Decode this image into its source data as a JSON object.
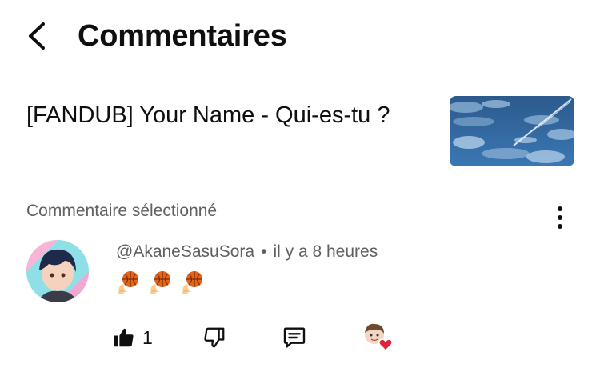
{
  "header": {
    "title": "Commentaires"
  },
  "video": {
    "title": "[FANDUB] Your Name - Qui-es-tu ?"
  },
  "comment": {
    "section_label": "Commentaire sélectionné",
    "author": "@AkaneSasuSora",
    "separator": "•",
    "time": "il y a 8 heures",
    "content_emojis": [
      "basketball-fire",
      "basketball-fire",
      "basketball-fire"
    ],
    "like_count": "1"
  },
  "icons": {
    "back": "chevron-left-icon",
    "menu": "more-vertical-icon",
    "like": "thumbs-up-filled-icon",
    "dislike": "thumbs-down-icon",
    "reply": "comment-icon",
    "creator_heart": "creator-heart-icon"
  },
  "colors": {
    "text": "#0f0f0f",
    "secondary": "#606060",
    "heart": "#e0233a"
  }
}
